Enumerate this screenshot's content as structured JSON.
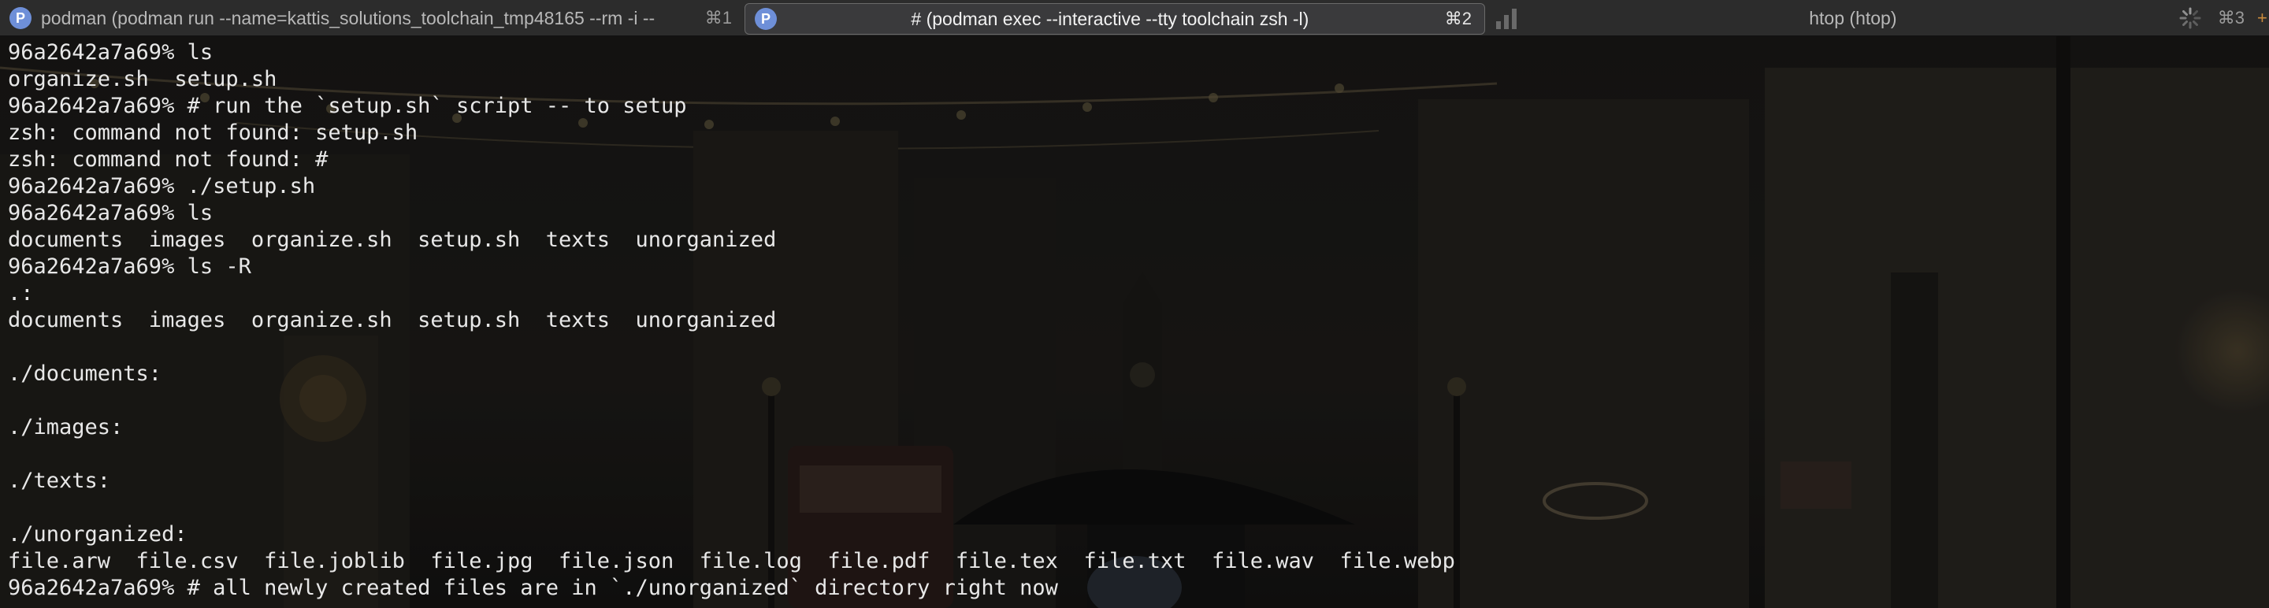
{
  "tabs": [
    {
      "title": "podman (podman run --name=kattis_solutions_toolchain_tmp48165 --rm -i --",
      "shortcut": "⌘1",
      "icon": "podman-icon",
      "active": false
    },
    {
      "title": "# (podman exec --interactive --tty toolchain zsh -l)",
      "shortcut": "⌘2",
      "icon": "podman-icon",
      "active": true
    },
    {
      "title": "htop (htop)",
      "shortcut": "⌘3",
      "icon": "activity-bars-icon",
      "active": false
    }
  ],
  "new_tab_label": "+",
  "terminal": {
    "lines": [
      "96a2642a7a69% ls",
      "organize.sh  setup.sh",
      "96a2642a7a69% # run the `setup.sh` script -- to setup",
      "zsh: command not found: setup.sh",
      "zsh: command not found: #",
      "96a2642a7a69% ./setup.sh",
      "96a2642a7a69% ls",
      "documents  images  organize.sh  setup.sh  texts  unorganized",
      "96a2642a7a69% ls -R",
      ".:",
      "documents  images  organize.sh  setup.sh  texts  unorganized",
      "",
      "./documents:",
      "",
      "./images:",
      "",
      "./texts:",
      "",
      "./unorganized:",
      "file.arw  file.csv  file.joblib  file.jpg  file.json  file.log  file.pdf  file.tex  file.txt  file.wav  file.webp",
      "96a2642a7a69% # all newly created files are in `./unorganized` directory right now"
    ]
  },
  "colors": {
    "tabbar_bg": "#2c2c2c",
    "active_tab_bg": "#3a3a3c",
    "terminal_text": "#e8e8e8",
    "podman_icon": "#6e8fd8",
    "new_tab_accent": "#c98a3b"
  }
}
